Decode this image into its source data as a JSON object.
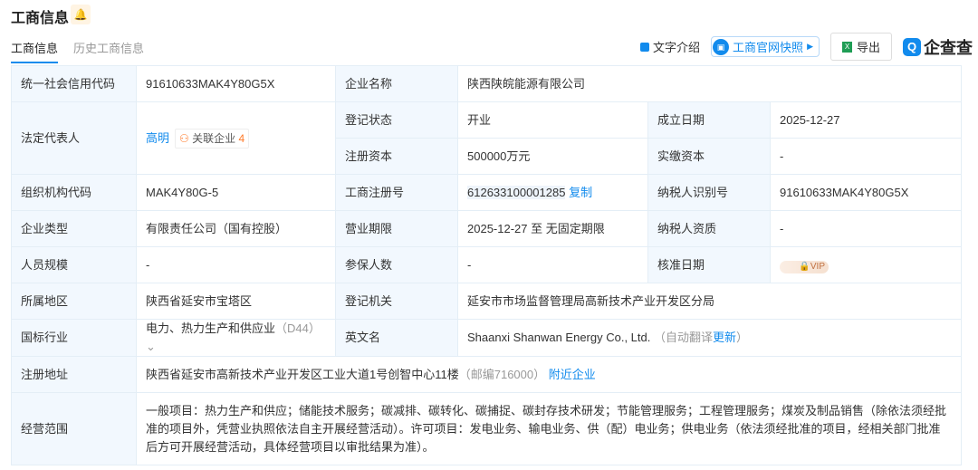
{
  "header": {
    "title": "工商信息",
    "tabs": [
      "工商信息",
      "历史工商信息"
    ],
    "text_intro": "文字介绍",
    "snapshot": "工商官网快照",
    "export": "导出",
    "logo": "企查查"
  },
  "rows": {
    "credit_code_label": "统一社会信用代码",
    "credit_code": "91610633MAK4Y80G5X",
    "name_label": "企业名称",
    "name": "陕西陕皖能源有限公司",
    "legal_label": "法定代表人",
    "legal": "高明",
    "related_label": "关联企业",
    "related_count": "4",
    "status_label": "登记状态",
    "status": "开业",
    "est_label": "成立日期",
    "est": "2025-12-27",
    "capital_label": "注册资本",
    "capital": "500000万元",
    "paid_label": "实缴资本",
    "paid": "-",
    "org_label": "组织机构代码",
    "org": "MAK4Y80G-5",
    "reg_no_label": "工商注册号",
    "reg_no": "612633100001285",
    "copy": "复制",
    "tax_label": "纳税人识别号",
    "tax": "91610633MAK4Y80G5X",
    "type_label": "企业类型",
    "type": "有限责任公司（国有控股）",
    "term_label": "营业期限",
    "term": "2025-12-27 至 无固定期限",
    "taxq_label": "纳税人资质",
    "taxq": "-",
    "staff_label": "人员规模",
    "staff": "-",
    "insured_label": "参保人数",
    "insured": "-",
    "approve_label": "核准日期",
    "vip": "VIP",
    "region_label": "所属地区",
    "region": "陕西省延安市宝塔区",
    "authority_label": "登记机关",
    "authority": "延安市市场监督管理局高新技术产业开发区分局",
    "industry_label": "国标行业",
    "industry": "电力、热力生产和供应业",
    "industry_code": "（D44）",
    "en_label": "英文名",
    "en": "Shaanxi Shanwan Energy Co., Ltd.",
    "auto_trans": "（自动翻译",
    "update": "更新",
    "close_paren": "）",
    "addr_label": "注册地址",
    "addr": "陕西省延安市高新技术产业开发区工业大道1号创智中心11楼",
    "postcode": "（邮编716000）",
    "nearby": "附近企业",
    "scope_label": "经营范围",
    "scope": "一般项目：热力生产和供应；储能技术服务；碳减排、碳转化、碳捕捉、碳封存技术研发；节能管理服务；工程管理服务；煤炭及制品销售（除依法须经批准的项目外，凭营业执照依法自主开展经营活动）。许可项目：发电业务、输电业务、供（配）电业务；供电业务（依法须经批准的项目，经相关部门批准后方可开展经营活动，具体经营项目以审批结果为准）。"
  }
}
